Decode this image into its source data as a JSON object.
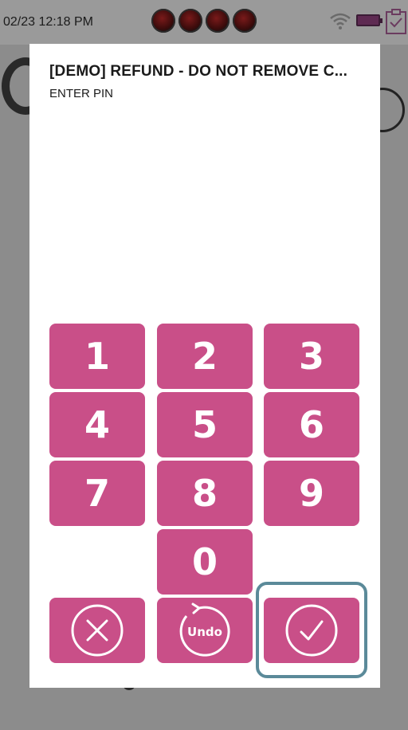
{
  "status_bar": {
    "datetime": "02/23 12:18 PM",
    "led_count": 4,
    "icons": [
      "wifi-icon",
      "battery-icon",
      "clipboard-icon"
    ]
  },
  "dialog": {
    "title": "[DEMO] REFUND - DO NOT REMOVE C...",
    "subtitle": "ENTER PIN"
  },
  "keypad": {
    "digits": [
      "1",
      "2",
      "3",
      "4",
      "5",
      "6",
      "7",
      "8",
      "9",
      "0"
    ],
    "cancel_icon": "close-circle-icon",
    "undo_label": "Undo",
    "undo_icon": "undo-arrow-icon",
    "confirm_icon": "check-circle-icon",
    "highlighted": "confirm"
  },
  "colors": {
    "key_background": "#c94f88",
    "key_text": "#ffffff",
    "overlay": "#8c8c8c",
    "highlight_border": "#5b8a99"
  }
}
